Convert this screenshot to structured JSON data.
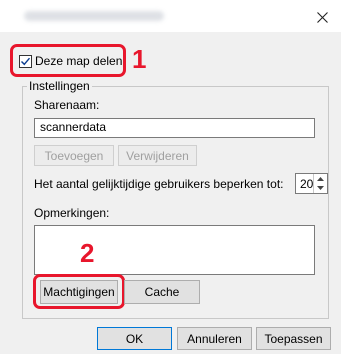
{
  "dialog": {
    "close_icon": "close-icon"
  },
  "share": {
    "checkbox_label": "Deze map delen",
    "checked": true
  },
  "settings": {
    "group_label": "Instellingen",
    "sharename_label": "Sharenaam:",
    "sharename_value": "scannerdata",
    "add_button": "Toevoegen",
    "remove_button": "Verwijderen",
    "limit_label": "Het aantal gelijktijdige gebruikers beperken tot:",
    "limit_value": "20",
    "comments_label": "Opmerkingen:",
    "comments_value": "",
    "permissions_button": "Machtigingen",
    "cache_button": "Cache"
  },
  "footer": {
    "ok_button": "OK",
    "cancel_button": "Annuleren",
    "apply_button": "Toepassen"
  },
  "callouts": [
    "1",
    "2"
  ],
  "colors": {
    "callout_red": "#e8162c",
    "accent_blue": "#0078d7"
  }
}
